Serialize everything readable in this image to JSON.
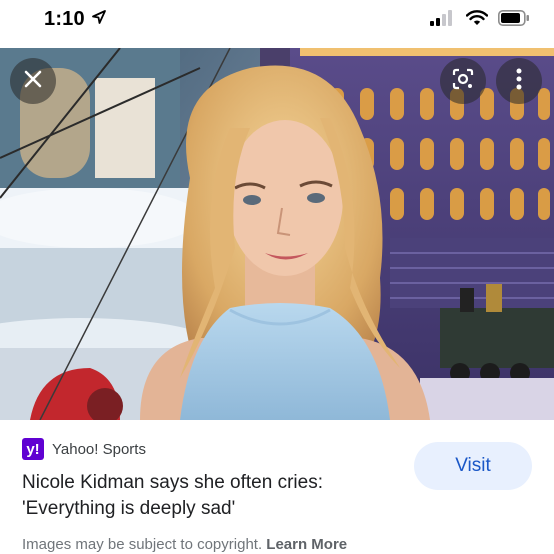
{
  "status_bar": {
    "time": "1:10"
  },
  "image": {
    "alt": "Nicole Kidman"
  },
  "source": {
    "favicon_text": "y!",
    "name": "Yahoo! Sports",
    "brand_color": "#6001d2"
  },
  "article": {
    "title_line1": "Nicole Kidman says she often cries:",
    "title_line2": "'Everything is deeply sad'"
  },
  "actions": {
    "visit_label": "Visit"
  },
  "footer": {
    "copyright_text": "Images may be subject to copyright. ",
    "learn_more_label": "Learn More"
  },
  "icons": [
    "location-arrow-icon",
    "signal-icon",
    "wifi-icon",
    "battery-icon",
    "close-icon",
    "lens-icon",
    "more-vert-icon"
  ]
}
